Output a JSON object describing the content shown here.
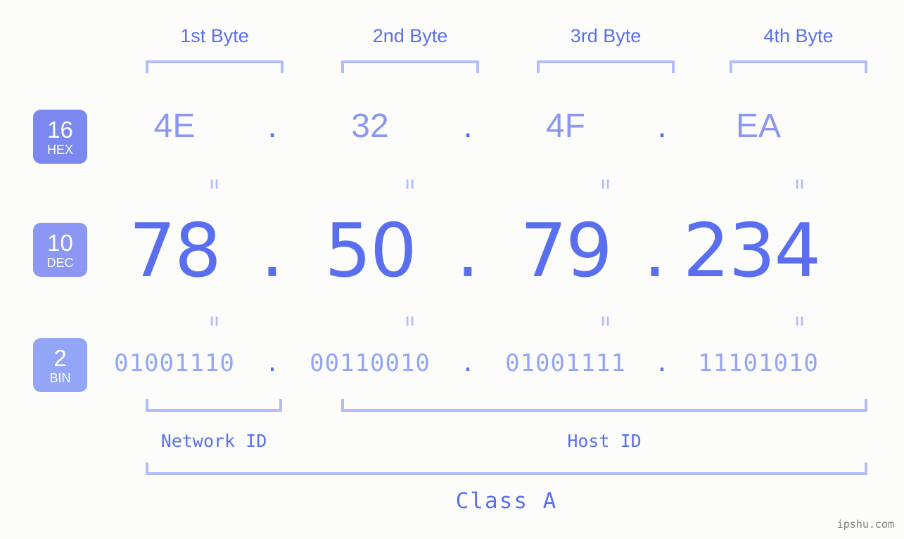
{
  "background_color": "#fcfdfa",
  "accent_color": "#5a6ff0",
  "accent_light_color": "#8b97f2",
  "accent_lighter_color": "#93a5f7",
  "bracket_color": "#b3bdfa",
  "byte_headers": [
    {
      "label": "1st Byte"
    },
    {
      "label": "2nd Byte"
    },
    {
      "label": "3rd Byte"
    },
    {
      "label": "4th Byte"
    }
  ],
  "radix_badges": [
    {
      "number": "16",
      "name": "HEX",
      "color": "#7b88ef"
    },
    {
      "number": "10",
      "name": "DEC",
      "color": "#8b97f2"
    },
    {
      "number": "2",
      "name": "BIN",
      "color": "#93a5f7"
    }
  ],
  "rows": {
    "hex": {
      "radix": "16",
      "radix_name": "HEX",
      "values": [
        "4E",
        "32",
        "4F",
        "EA"
      ],
      "separator": "."
    },
    "dec": {
      "radix": "10",
      "radix_name": "DEC",
      "values": [
        "78",
        "50",
        "79",
        "234"
      ],
      "separator": "."
    },
    "bin": {
      "radix": "2",
      "radix_name": "BIN",
      "values": [
        "01001110",
        "00110010",
        "01001111",
        "11101010"
      ],
      "separator": "."
    }
  },
  "equals_mark": "=",
  "sections": {
    "network_id": "Network ID",
    "host_id": "Host ID",
    "class": "Class A"
  },
  "watermark": "ipshu.com"
}
